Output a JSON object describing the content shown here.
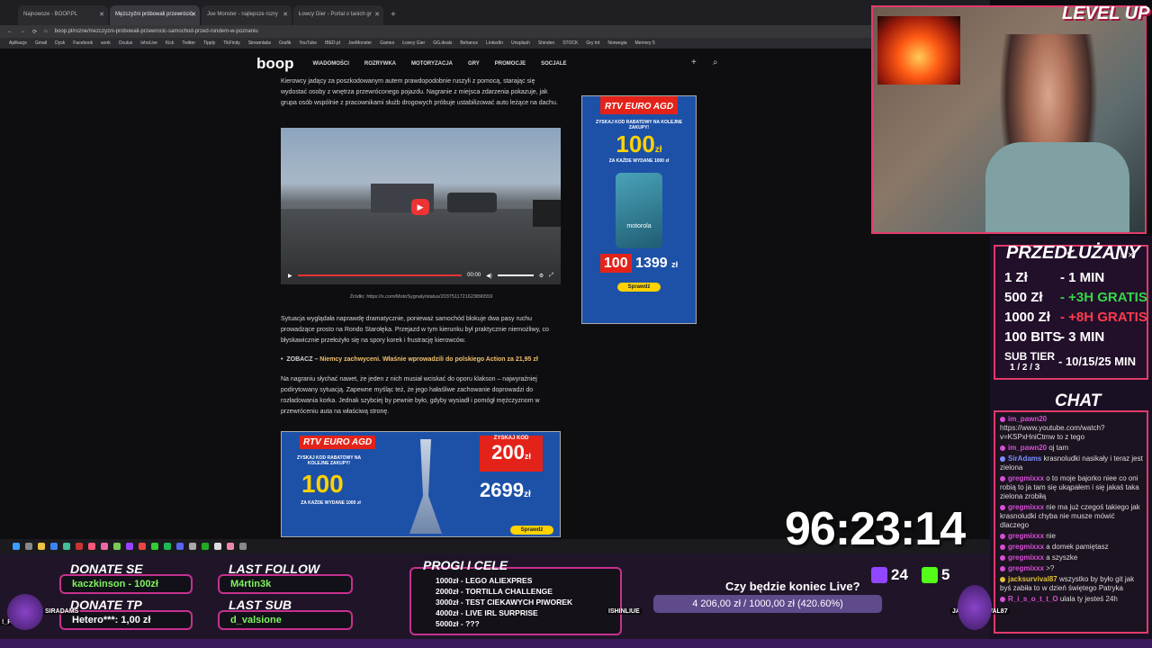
{
  "browser": {
    "tabs": [
      "Najnowsze - BOOP.PL",
      "Mężczyźni próbowali przewrócić",
      "Joe Monster - najlepsze rozry",
      "Łowcy Gier - Portal o tanich gr"
    ],
    "url": "boop.pl/rozne/mezczyzni-probowali-przewrocic-samochod-przed-rondem-w-poznaniu",
    "bookmarks": [
      "Aplikacje",
      "Gmail",
      "Dysk",
      "Facebook",
      "work",
      "Oculus",
      "IshoLive",
      "Kick",
      "Twitter",
      "Tipply",
      "TikFinity",
      "Streamlabs",
      "Grafik",
      "YouTube",
      "IBED.pl",
      "JoeMonster",
      "Games",
      "Łowcy Gier",
      "GG.deals",
      "Behance",
      "LinkedIn",
      "Unsplash",
      "Shinden",
      "STOCK",
      "Gry tnt",
      "Norwegia",
      "Memory 5"
    ]
  },
  "site": {
    "logo": "boop",
    "nav": [
      "WIADOMOŚCI",
      "ROZRYWKA",
      "MOTORYZACJA",
      "GRY",
      "PROMOCJE",
      "SOCJALE"
    ],
    "para1": "Kierowcy jadący za poszkodowanym autem prawdopodobnie ruszyli z pomocą, starając się wydostać osoby z wnętrza przewróconego pojazdu. Nagranie z miejsca zdarzenia pokazuje, jak grupa osób wspólnie z pracownikami służb drogowych próbuje ustabilizować auto leżące na dachu.",
    "video_time": "00:00",
    "source": "Źródło: https://x.com/MotoSygnaly/status/2037511721623896559",
    "para2": "Sytuacja wyglądała naprawdę dramatycznie, ponieważ samochód blokuje dwa pasy ruchu prowadzące prosto na Rondo Starołęka. Przejazd w tym kierunku był praktycznie niemożliwy, co błyskawicznie przełożyło się na spory korek i frustrację kierowców.",
    "zobacz_prefix": "ZOBACZ – ",
    "zobacz_link": "Niemcy zachwyceni. Właśnie wprowadzili do polskiego Action za 21,95 zł",
    "para3": "Na nagraniu słychać nawet, że jeden z nich musiał wciskać do oporu klakson – najwyraźniej podirytowany sytuacją. Zapewne myśląc też, że jego hałaśliwe zachowanie doprowadzi do rozładowania korka. Jednak szybciej by pewnie było, gdyby wysiadł i pomógł mężczyznom w przewróceniu auta na właściwą stronę.",
    "ad_side": {
      "brand": "RTV EURO AGD",
      "headline": "ZYSKAJ KOD RABATOWY NA KOLEJNE ZAKUPY!",
      "amount": "100",
      "unit": "zł",
      "condition": "ZA KAŻDE WYDANE 1000 zł",
      "phone": "motorola",
      "price": "1399",
      "price_unit": "zł",
      "cta": "Sprawdź"
    },
    "ad_bottom": {
      "brand": "RTV EURO AGD",
      "headline": "ZYSKAJ KOD RABATOWY NA KOLEJNE ZAKUPY!",
      "amount": "100",
      "condition": "ZA KAŻDE WYDANE 1000 zł",
      "code_label": "ZYSKAJ KOD",
      "code_amount": "200",
      "code_unit": "zł",
      "price": "2699",
      "price_unit": "zł",
      "cta": "Sprawdź"
    }
  },
  "overlay": {
    "timer": "96:23:14",
    "level_logo": "LEVEL UP",
    "przedluzany": {
      "title": "PRZEDŁUŻANY",
      "rows": [
        {
          "left": "1 Zł",
          "right": "- 1 MIN"
        },
        {
          "left": "500 Zł",
          "right": "- +3H GRATIS"
        },
        {
          "left": "1000 Zł",
          "right": "- +8H GRATIS"
        },
        {
          "left": "100 BITS",
          "right": "- 3 MIN"
        },
        {
          "left": "SUB TIER",
          "sub": "1 / 2 / 3",
          "right": "- 10/15/25 MIN"
        }
      ]
    },
    "chat_title": "CHAT",
    "chat": [
      {
        "user": "im_pawn20",
        "text": "https://www.youtube.com/watch?v=KSPxHniCtmw to z tego",
        "color": "#d94ed6"
      },
      {
        "user": "im_pawn20",
        "text": "oj tam",
        "color": "#d94ed6"
      },
      {
        "user": "SirAdams",
        "text": "krasnoludki nasikały i teraz jest zielona",
        "color": "#7a8cff"
      },
      {
        "user": "gregmixxx",
        "text": "o to moje bajorko niee co oni robią to ja tam się ukąpałem i się jakaś taka zielona zrobiłą",
        "color": "#d94ed6"
      },
      {
        "user": "gregmixxx",
        "text": "nie ma już czegoś takiego jak krasnoludki chyba nie musze mówić dlaczego",
        "color": "#d94ed6"
      },
      {
        "user": "gregmixxx",
        "text": "nie",
        "color": "#d94ed6"
      },
      {
        "user": "gregmixxx",
        "text": "a domek pamiętasz",
        "color": "#d94ed6"
      },
      {
        "user": "gregmixxx",
        "text": "a szyszke",
        "color": "#d94ed6"
      },
      {
        "user": "gregmixxx",
        "text": ">?",
        "color": "#d94ed6"
      },
      {
        "user": "jacksurvival87",
        "text": "wszystko by było git jak byś zabiła to w dzień świętego Patryka",
        "color": "#e0c23a"
      },
      {
        "user": "R_i_s_o_t_t_O",
        "text": "ulala ty jesteś 24h",
        "color": "#d94ed6"
      }
    ],
    "donate_se": {
      "label": "DONATE SE",
      "value": "kaczkinson - 100zł"
    },
    "donate_tp": {
      "label": "DONATE TP",
      "value": "Hetero***: 1,00 zł"
    },
    "last_follow": {
      "label": "LAST FOLLOW",
      "value": "M4rtin3k"
    },
    "last_sub": {
      "label": "LAST SUB",
      "value": "d_valsione"
    },
    "progi": {
      "title": "PROGI I CELE",
      "goals": [
        "1000zł - LEGO ALIEXPRES",
        "2000zł - TORTILLA CHALLENGE",
        "3000zł - TEST CIEKAWYCH PIWOREK",
        "4000zł - LIVE IRL SURPRISE",
        "5000zł - ???"
      ]
    },
    "live_question": "Czy będzie koniec Live?",
    "goal_text": "4 206,00 zł / 1000,00 zł (420.60%)",
    "goal_fraction": 1.0,
    "twitch_count": "24",
    "kick_count": "5",
    "name_tags": [
      "SIRADAMS",
      "!_PAWN20",
      "ISHINLIUE",
      "JACKSURVIVAL87"
    ],
    "colors": {
      "accent": "#e23a6b",
      "green": "#34d64a",
      "red": "#ff3b4e",
      "twitch": "#9146ff",
      "kick": "#53fc18"
    }
  }
}
